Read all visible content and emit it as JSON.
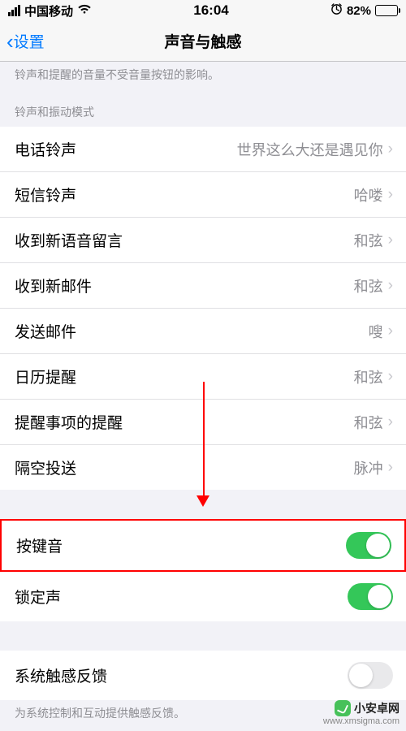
{
  "statusBar": {
    "carrier": "中国移动",
    "time": "16:04",
    "batteryPct": "82%"
  },
  "nav": {
    "back": "设置",
    "title": "声音与触感"
  },
  "hints": {
    "ringerNote": "铃声和提醒的音量不受音量按钮的影响。",
    "hapticsNote": "为系统控制和互动提供触感反馈。"
  },
  "sections": {
    "ringtonePatternsHeader": "铃声和振动模式"
  },
  "rows": {
    "ringtone": {
      "label": "电话铃声",
      "value": "世界这么大还是遇见你"
    },
    "textTone": {
      "label": "短信铃声",
      "value": "哈喽"
    },
    "voicemail": {
      "label": "收到新语音留言",
      "value": "和弦"
    },
    "newMail": {
      "label": "收到新邮件",
      "value": "和弦"
    },
    "sentMail": {
      "label": "发送邮件",
      "value": "嗖"
    },
    "calendar": {
      "label": "日历提醒",
      "value": "和弦"
    },
    "reminders": {
      "label": "提醒事项的提醒",
      "value": "和弦"
    },
    "airdrop": {
      "label": "隔空投送",
      "value": "脉冲"
    },
    "keyClicks": {
      "label": "按键音",
      "on": true
    },
    "lockSound": {
      "label": "锁定声",
      "on": true
    },
    "sysHaptics": {
      "label": "系统触感反馈",
      "on": false
    }
  },
  "watermark": {
    "brand": "小安卓网",
    "url": "www.xmsigma.com"
  }
}
